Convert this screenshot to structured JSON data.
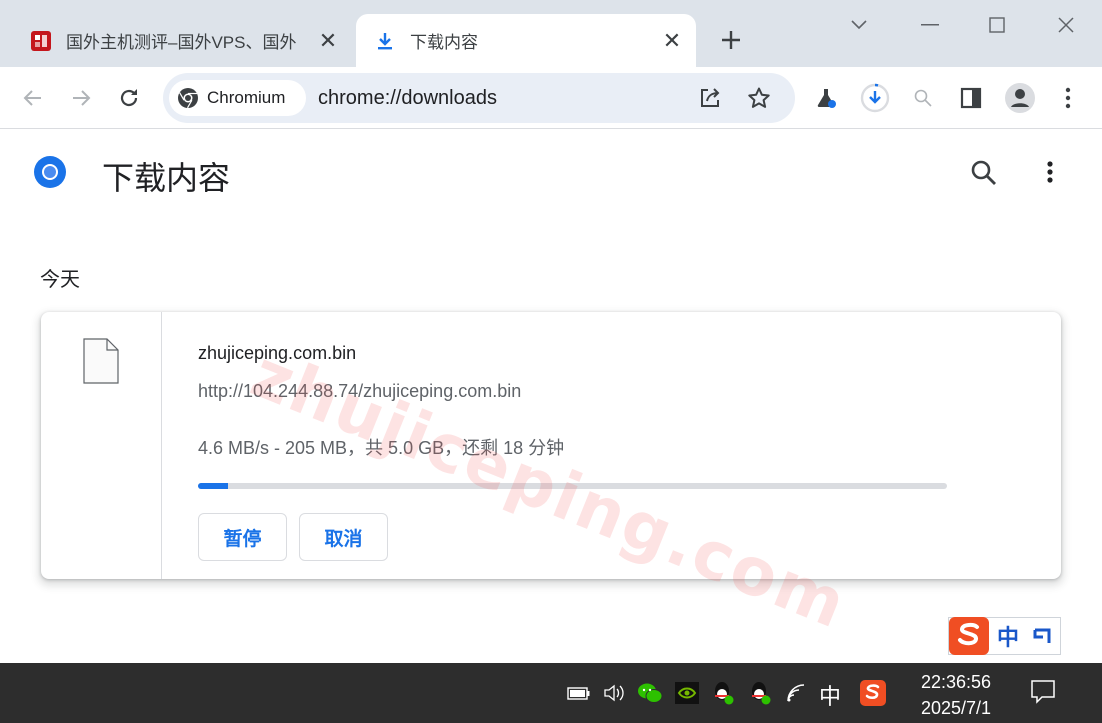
{
  "tabs": [
    {
      "title": "国外主机测评–国外VPS、国外",
      "active": false
    },
    {
      "title": "下载内容",
      "active": true
    }
  ],
  "omnibox": {
    "chip_label": "Chromium",
    "url": "chrome://downloads"
  },
  "page": {
    "title": "下载内容",
    "section_label": "今天"
  },
  "download": {
    "filename": "zhujiceping.com.bin",
    "url": "http://104.244.88.74/zhujiceping.com.bin",
    "status": "4.6 MB/s - 205 MB，共 5.0 GB，还剩 18 分钟",
    "progress": 0.04,
    "pause_label": "暂停",
    "cancel_label": "取消"
  },
  "watermark": "zhujiceping.com",
  "ime_badge": {
    "mode": "中"
  },
  "taskbar": {
    "ime": "中",
    "time": "22:36:56",
    "date": "2025/7/1"
  },
  "colors": {
    "accent": "#1a73e8",
    "tabstrip": "#dde3ea",
    "omnibox": "#e9eef6",
    "taskbar": "#2d2d2d"
  },
  "icons": {
    "back": "arrow-left-icon",
    "forward": "arrow-right-icon",
    "reload": "reload-icon",
    "share": "share-icon",
    "bookmark": "star-icon",
    "labs": "flask-icon",
    "downloads": "download-progress-icon",
    "zoom": "magnifier-icon",
    "side_panel": "side-panel-icon",
    "profile": "avatar-icon",
    "menu": "more-vert-icon"
  }
}
